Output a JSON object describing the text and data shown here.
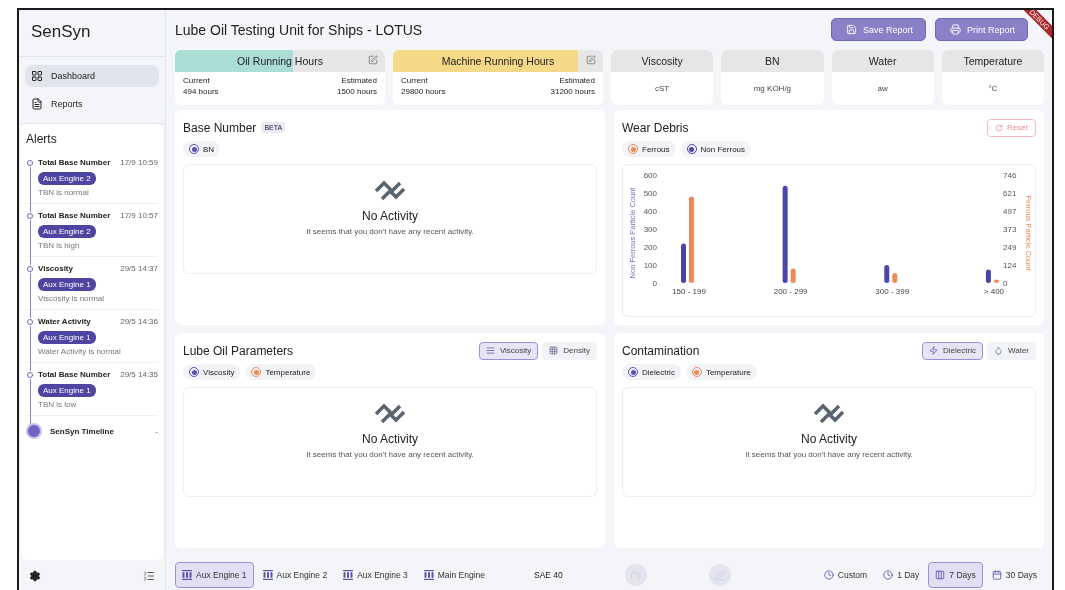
{
  "app": {
    "logo": "SenSyn",
    "debug_banner": "DEBUG"
  },
  "nav": [
    {
      "label": "Dashboard",
      "selected": true
    },
    {
      "label": "Reports",
      "selected": false
    }
  ],
  "alerts": {
    "title": "Alerts",
    "items": [
      {
        "title": "Total Base Number",
        "time": "17/9 10:59",
        "tag": "Aux Engine 2",
        "message": "TBN is normal"
      },
      {
        "title": "Total Base Number",
        "time": "17/9 10:57",
        "tag": "Aux Engine 2",
        "message": "TBN is high"
      },
      {
        "title": "Viscosity",
        "time": "29/5 14:37",
        "tag": "Aux Engine 1",
        "message": "Viscosity is normal"
      },
      {
        "title": "Water Activity",
        "time": "29/5 14:36",
        "tag": "Aux Engine 1",
        "message": "Water Activity is normal"
      },
      {
        "title": "Total Base Number",
        "time": "29/5 14:35",
        "tag": "Aux Engine 1",
        "message": "TBN is low"
      }
    ],
    "footer": {
      "label": "SenSyn Timeline",
      "value": "-"
    }
  },
  "header": {
    "title": "Lube Oil Testing Unit for Ships - LOTUS",
    "buttons": [
      "Save Report",
      "Print Report"
    ]
  },
  "hour_cards": [
    {
      "title": "Oil Running Hours",
      "level": 0.56,
      "color": "#a9ddd6",
      "current_label": "Current",
      "current": "494 hours",
      "estimated_label": "Estimated",
      "estimated": "1500 hours"
    },
    {
      "title": "Machine Running Hours",
      "level": 0.88,
      "color": "#f6d889",
      "current_label": "Current",
      "current": "29800 hours",
      "estimated_label": "Estimated",
      "estimated": "31200 hours"
    }
  ],
  "unit_cards": [
    {
      "title": "Viscosity",
      "unit": "cST"
    },
    {
      "title": "BN",
      "unit": "mg KOH/g"
    },
    {
      "title": "Water",
      "unit": "aw"
    },
    {
      "title": "Temperature",
      "unit": "°C"
    }
  ],
  "panels": [
    {
      "kind": "empty",
      "title": "Base Number",
      "badge": "BETA",
      "legend": [
        {
          "label": "BN",
          "color": "#5b52b0"
        }
      ],
      "empty_title": "No Activity",
      "empty_text": "It seems that you don't have any recent activity."
    },
    {
      "kind": "chart",
      "title": "Wear Debris",
      "reset": "Reset",
      "right_ticks": [
        "746",
        "621",
        "497",
        "373",
        "249",
        "124",
        "0"
      ],
      "right_axis_label": "Ferrous Particle Count",
      "chart_data": {
        "type": "bar",
        "categories": [
          "150 - 199",
          "200 - 299",
          "300 - 399",
          "> 400"
        ],
        "ylabel": "Non Ferrous Particle Count",
        "yticks": [
          0,
          100,
          200,
          300,
          400,
          500,
          600
        ],
        "ylim": [
          0,
          600
        ],
        "series": [
          {
            "name": "Ferrous",
            "color": "#ef8a55",
            "values": [
              480,
              80,
              55,
              20
            ]
          },
          {
            "name": "Non Ferrous",
            "color": "#4b45a6",
            "values": [
              220,
              540,
              100,
              75
            ]
          }
        ]
      }
    },
    {
      "kind": "empty",
      "title": "Lube Oil Parameters",
      "toggles": [
        {
          "label": "Viscosity",
          "selected": true
        },
        {
          "label": "Density",
          "selected": false
        }
      ],
      "legend": [
        {
          "label": "Viscosity",
          "color": "#5b52b0"
        },
        {
          "label": "Temperature",
          "color": "#ef8a55"
        }
      ],
      "empty_title": "No Activity",
      "empty_text": "It seems that you don't have any recent activity."
    },
    {
      "kind": "empty",
      "title": "Contamination",
      "toggles": [
        {
          "label": "Dielectric",
          "selected": true
        },
        {
          "label": "Water",
          "selected": false
        }
      ],
      "legend": [
        {
          "label": "Dielectric",
          "color": "#5b52b0"
        },
        {
          "label": "Temperature",
          "color": "#ef8a55"
        }
      ],
      "empty_title": "No Activity",
      "empty_text": "It seems that you don't have any recent activity."
    }
  ],
  "bottom_bar": {
    "engines": [
      {
        "label": "Aux Engine 1",
        "selected": true
      },
      {
        "label": "Aux Engine 2",
        "selected": false
      },
      {
        "label": "Aux Engine 3",
        "selected": false
      },
      {
        "label": "Main Engine",
        "selected": false
      }
    ],
    "oil_grade": "SAE 40",
    "ranges": [
      {
        "label": "Custom",
        "selected": false
      },
      {
        "label": "1 Day",
        "selected": false
      },
      {
        "label": "7 Days",
        "selected": true
      },
      {
        "label": "30 Days",
        "selected": false
      }
    ]
  }
}
